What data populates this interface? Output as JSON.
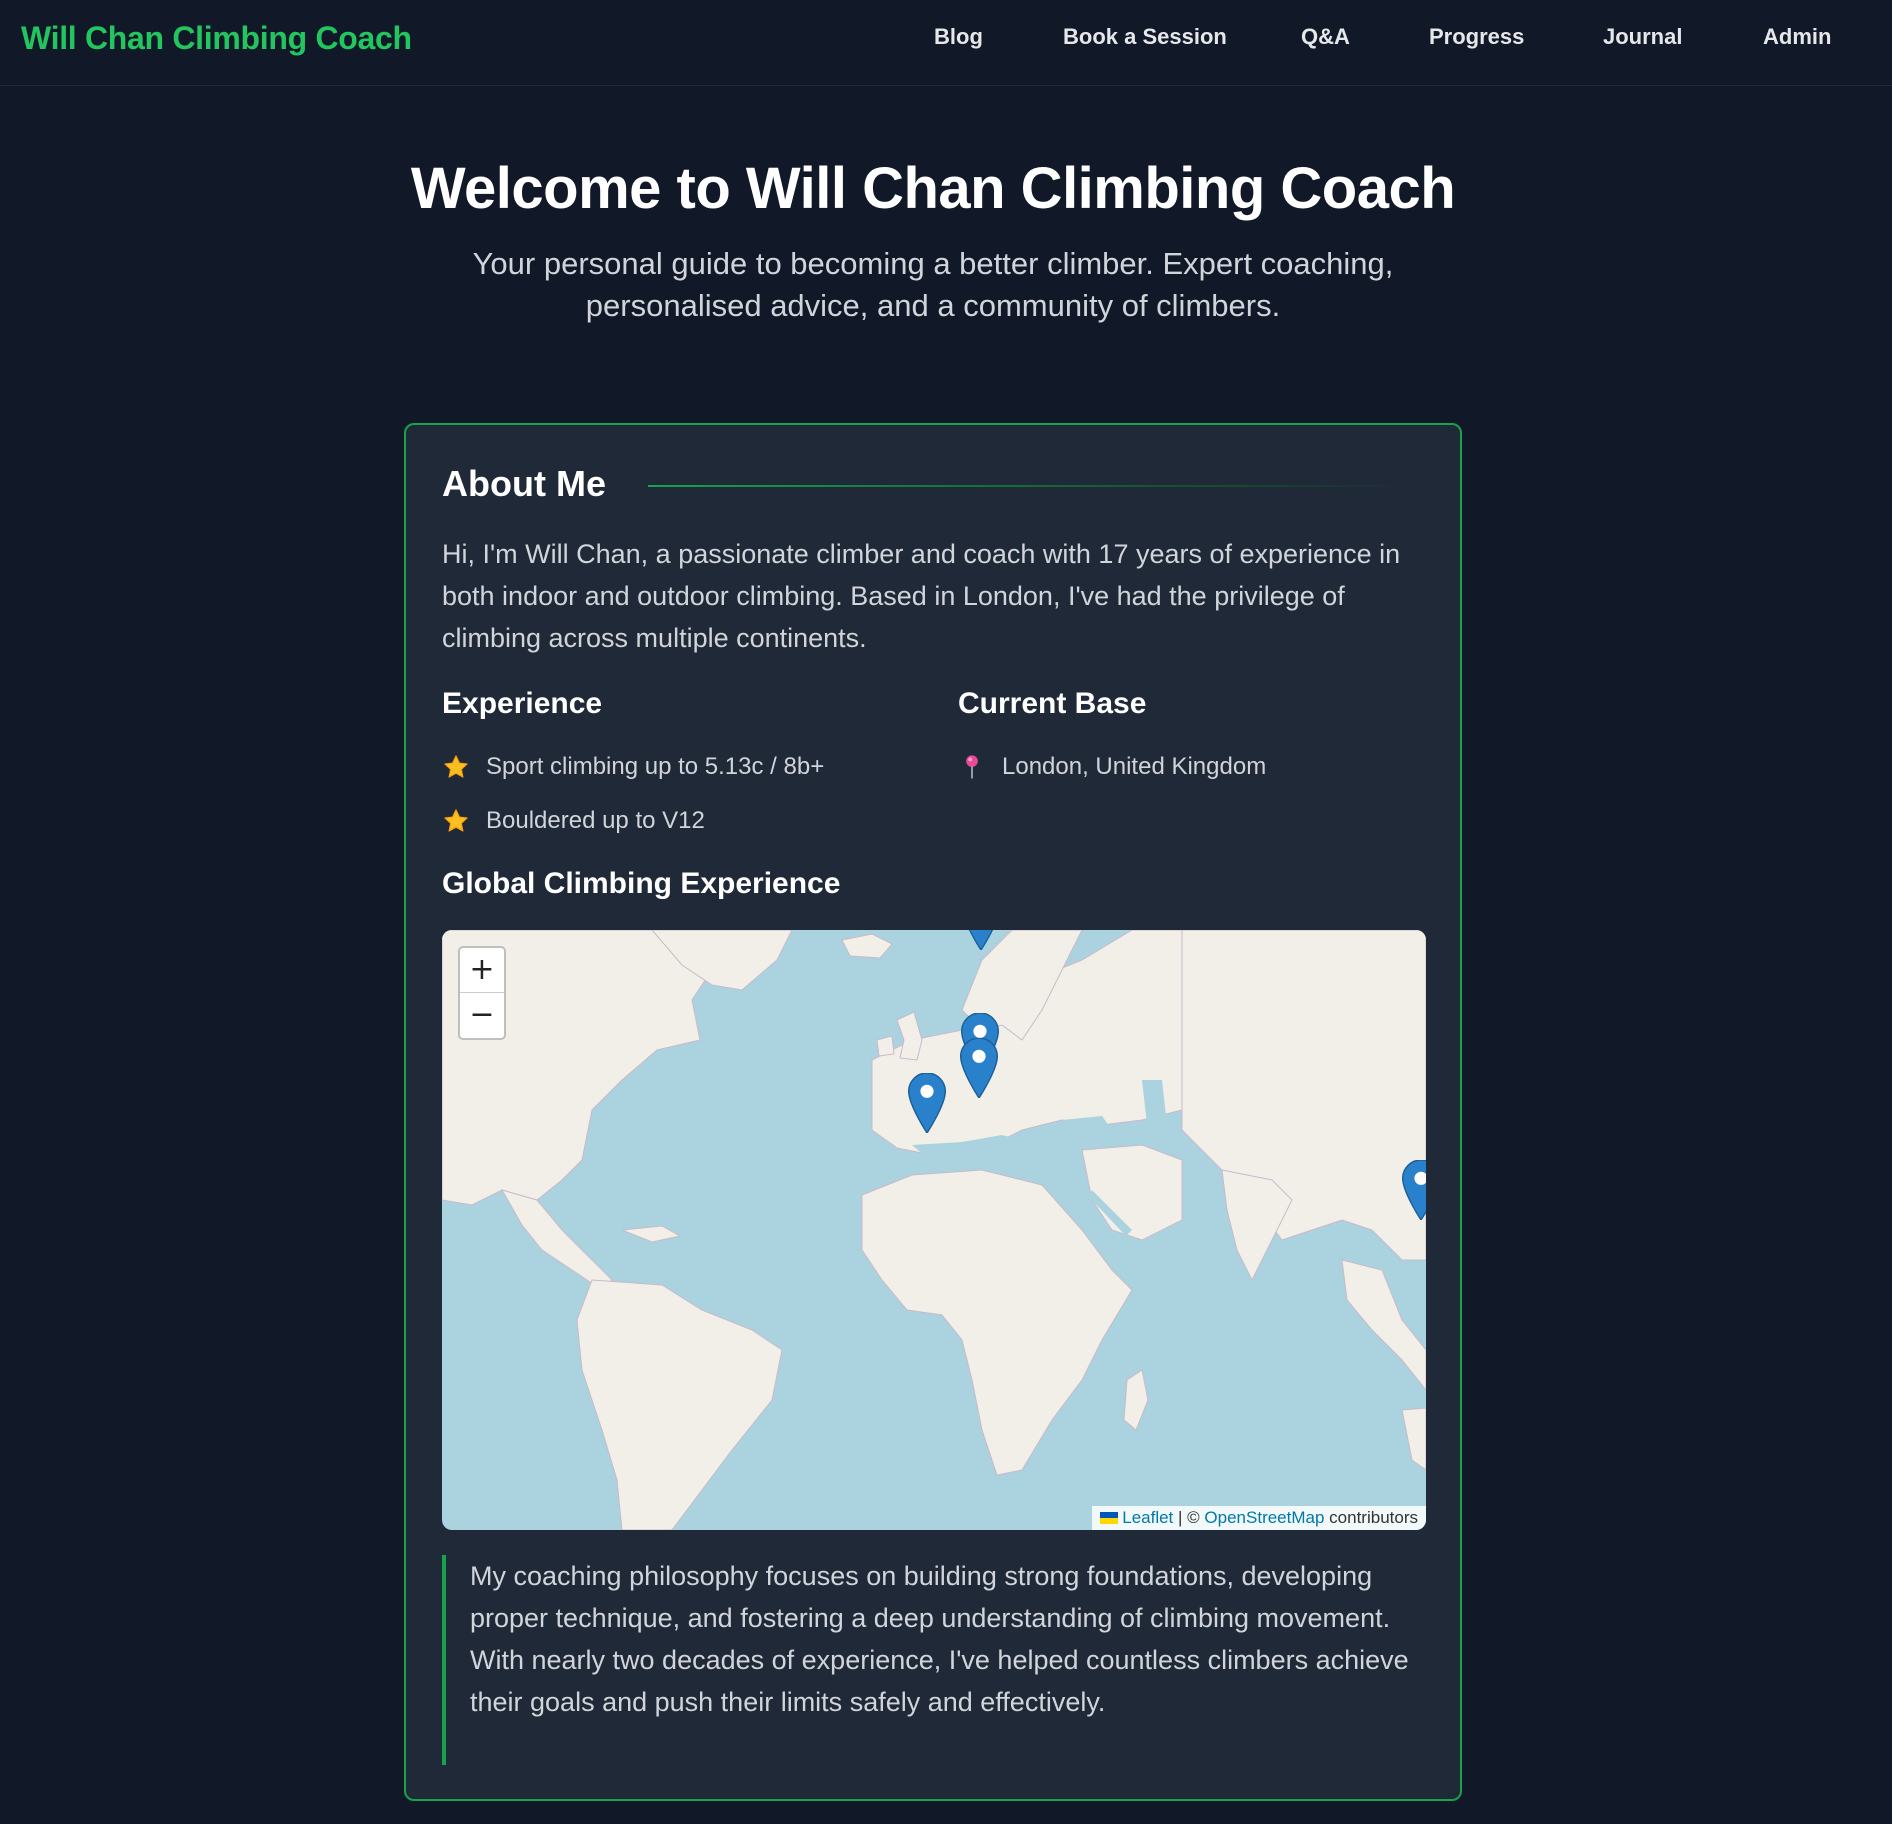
{
  "nav": {
    "brand": "Will Chan Climbing Coach",
    "links": [
      {
        "label": "Blog"
      },
      {
        "label": "Book a Session"
      },
      {
        "label": "Q&A"
      },
      {
        "label": "Progress"
      },
      {
        "label": "Journal"
      },
      {
        "label": "Admin"
      }
    ]
  },
  "hero": {
    "title": "Welcome to Will Chan Climbing Coach",
    "subtitle": "Your personal guide to becoming a better climber. Expert coaching, personalised advice, and a community of climbers."
  },
  "about": {
    "title": "About Me",
    "intro": "Hi, I'm Will Chan, a passionate climber and coach with 17 years of experience in both indoor and outdoor climbing. Based in London, I've had the privilege of climbing across multiple continents.",
    "experience": {
      "heading": "Experience",
      "items": [
        {
          "text": "Sport climbing up to 5.13c / 8b+",
          "icon": "star-icon"
        },
        {
          "text": "Bouldered up to V12",
          "icon": "star-icon"
        }
      ]
    },
    "base": {
      "heading": "Current Base",
      "items": [
        {
          "text": "London, United Kingdom",
          "icon": "pushpin-icon"
        }
      ]
    },
    "map": {
      "heading": "Global Climbing Experience",
      "zoom_in": "+",
      "zoom_out": "−",
      "attribution": {
        "leaflet": "Leaflet",
        "separator": "| ©",
        "osm": "OpenStreetMap",
        "suffix": "contributors"
      }
    },
    "philosophy": "My coaching philosophy focuses on building strong foundations, developing proper technique, and fostering a deep understanding of climbing movement. With nearly two decades of experience, I've helped countless climbers achieve their goals and push their limits safely and effectively."
  },
  "colors": {
    "accent": "#22c55e",
    "background": "#111827",
    "card": "#1f2937",
    "marker": "#2a81cb",
    "water": "#aad3df",
    "land": "#f2efe9"
  }
}
